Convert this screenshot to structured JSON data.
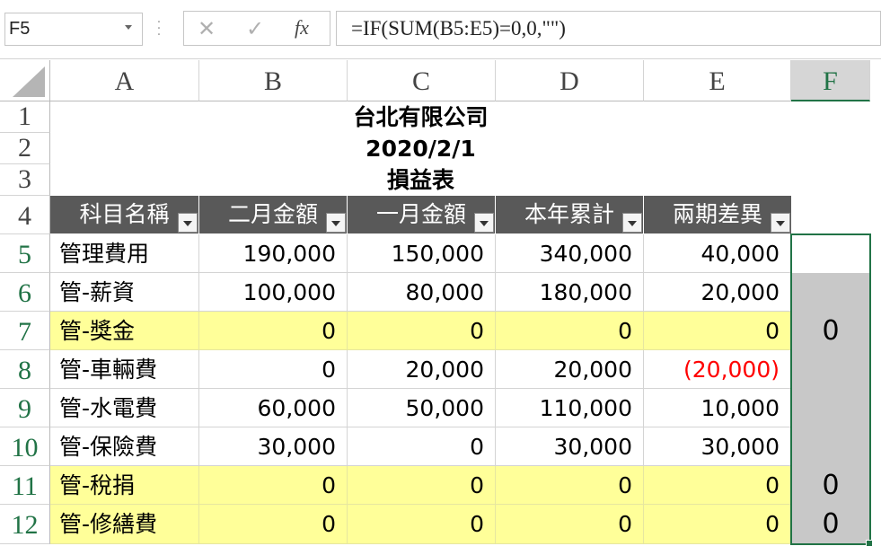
{
  "formula_bar": {
    "name_box": "F5",
    "cancel_icon": "✕",
    "enter_icon": "✓",
    "fx_label": "fx",
    "formula": "=IF(SUM(B5:E5)=0,0,\"\")"
  },
  "columns": [
    "A",
    "B",
    "C",
    "D",
    "E",
    "F"
  ],
  "selected_column": "F",
  "rows": [
    "1",
    "2",
    "3",
    "4",
    "5",
    "6",
    "7",
    "8",
    "9",
    "10",
    "11",
    "12"
  ],
  "title": {
    "company": "台北有限公司",
    "date": "2020/2/1",
    "report": "損益表"
  },
  "table": {
    "headers": [
      "科目名稱",
      "二月金額",
      "一月金額",
      "本年累計",
      "兩期差異"
    ],
    "rows": [
      {
        "name": "管理費用",
        "b": "190,000",
        "c": "150,000",
        "d": "340,000",
        "e": "40,000",
        "f": ""
      },
      {
        "name": " 管-薪資",
        "b": "100,000",
        "c": "80,000",
        "d": "180,000",
        "e": "20,000",
        "f": ""
      },
      {
        "name": " 管-獎金",
        "b": "0",
        "c": "0",
        "d": "0",
        "e": "0",
        "f": "0"
      },
      {
        "name": " 管-車輛費",
        "b": "0",
        "c": "20,000",
        "d": "20,000",
        "e": "(20,000)",
        "f": ""
      },
      {
        "name": " 管-水電費",
        "b": "60,000",
        "c": "50,000",
        "d": "110,000",
        "e": "10,000",
        "f": ""
      },
      {
        "name": " 管-保險費",
        "b": "30,000",
        "c": "0",
        "d": "30,000",
        "e": "30,000",
        "f": ""
      },
      {
        "name": " 管-稅捐",
        "b": "0",
        "c": "0",
        "d": "0",
        "e": "0",
        "f": "0"
      },
      {
        "name": " 管-修繕費",
        "b": "0",
        "c": "0",
        "d": "0",
        "e": "0",
        "f": "0"
      }
    ]
  },
  "colors": {
    "header_fill": "#595959",
    "zero_row_fill": "#ffff99",
    "negative": "#ff0000",
    "selection": "#217346"
  }
}
